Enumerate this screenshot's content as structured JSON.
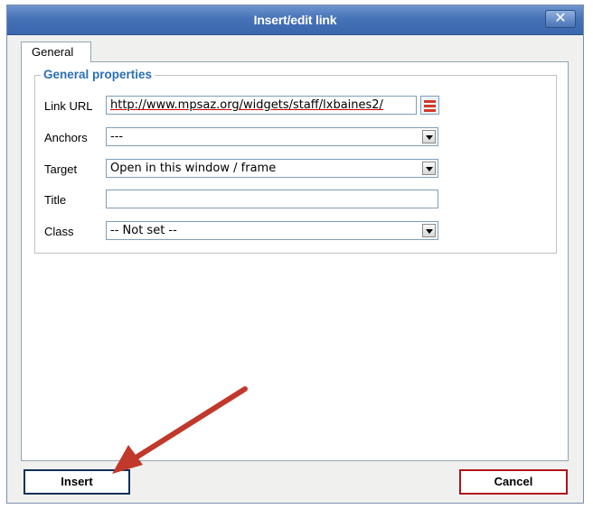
{
  "dialog": {
    "title": "Insert/edit link",
    "close_label": "✕"
  },
  "tabs": [
    {
      "label": "General"
    }
  ],
  "general_properties": {
    "legend": "General properties",
    "link_url": {
      "label": "Link URL",
      "value": "http://www.mpsaz.org/widgets/staff/lxbaines2/"
    },
    "anchors": {
      "label": "Anchors",
      "value": "---"
    },
    "target": {
      "label": "Target",
      "value": "Open in this window / frame"
    },
    "title": {
      "label": "Title",
      "value": ""
    },
    "class": {
      "label": "Class",
      "value": "-- Not set --"
    }
  },
  "buttons": {
    "insert": "Insert",
    "cancel": "Cancel"
  },
  "annotation": {
    "arrow_color": "#c0392b"
  }
}
